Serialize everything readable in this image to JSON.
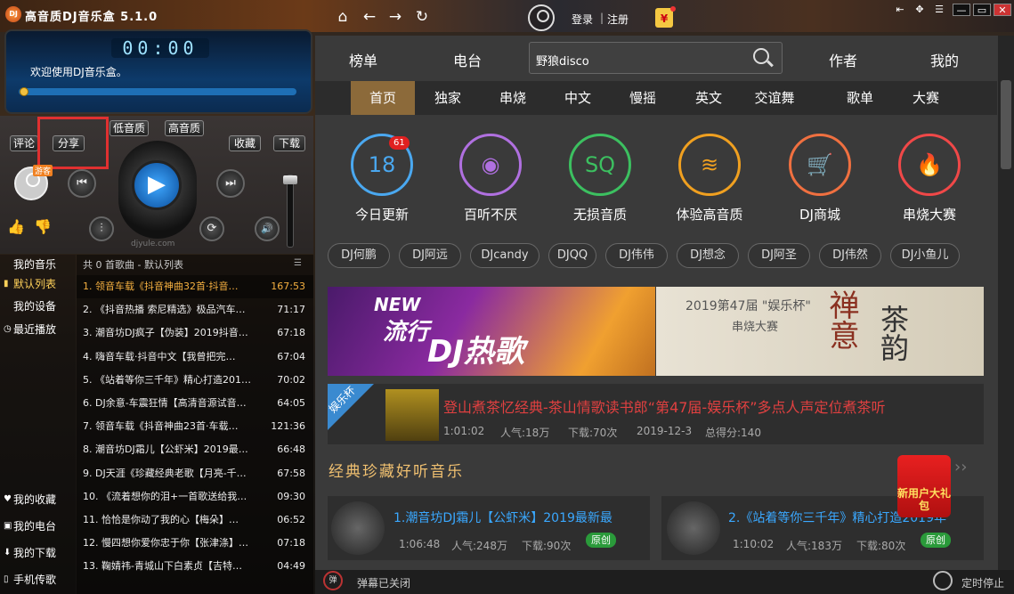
{
  "app": {
    "title": "高音质DJ音乐盒 5.1.0",
    "logo_text": "DJ"
  },
  "topbar": {
    "login": "登录",
    "separator": "|",
    "register": "注册",
    "redpacket": "¥"
  },
  "player": {
    "time": "00:00",
    "welcome": "欢迎使用DJ音乐盒。",
    "progress": 0,
    "buttons": {
      "comment": "评论",
      "share": "分享",
      "low_quality": "低音质",
      "high_quality": "高音质",
      "collect": "收藏",
      "download": "下载"
    },
    "visitor_badge": "游客",
    "watermark": "djyule.com",
    "icons": {
      "prev": "⏮",
      "play": "▶",
      "next": "⏭",
      "eq": "⫶",
      "loop": "⟳",
      "volume": "🔊"
    }
  },
  "menu": {
    "top": [
      {
        "label": "我的音乐",
        "icon": ""
      },
      {
        "label": "默认列表",
        "icon": "▮"
      },
      {
        "label": "我的设备",
        "icon": ""
      },
      {
        "label": "最近播放",
        "icon": "◷"
      }
    ],
    "bottom": [
      {
        "label": "我的收藏",
        "icon": "♥"
      },
      {
        "label": "我的电台",
        "icon": "▣"
      },
      {
        "label": "我的下载",
        "icon": "⬇"
      },
      {
        "label": "手机传歌",
        "icon": "▯"
      }
    ]
  },
  "playlist": {
    "header": "共 0 首歌曲 - 默认列表",
    "rows": [
      {
        "title": "1. 领音车载《抖音神曲32首·抖音…",
        "duration": "167:53"
      },
      {
        "title": "2. 《抖音热播 索尼精选》极品汽车…",
        "duration": "71:17"
      },
      {
        "title": "3. 潮音坊DJ疯子【伪装】2019抖音…",
        "duration": "67:18"
      },
      {
        "title": "4. 嗨音车载·抖音中文【我曾把完…",
        "duration": "67:04"
      },
      {
        "title": "5. 《站着等你三千年》精心打造201…",
        "duration": "70:02"
      },
      {
        "title": "6. DJ余意-车震狂情【高清音源试音…",
        "duration": "64:05"
      },
      {
        "title": "7. 领音车载《抖音神曲23首·车载…",
        "duration": "121:36"
      },
      {
        "title": "8. 潮音坊DJ霜儿【公虾米】2019最…",
        "duration": "66:48"
      },
      {
        "title": "9. DJ天涯《珍藏经典老歌【月亮-千…",
        "duration": "67:58"
      },
      {
        "title": "10. 《流着想你的泪+一首歌送给我…",
        "duration": "09:30"
      },
      {
        "title": "11. 恰恰是你动了我的心【梅朵】…",
        "duration": "06:52"
      },
      {
        "title": "12. 慢四想你爱你忠于你【张津涤】…",
        "duration": "07:18"
      },
      {
        "title": "13. 鞠婧祎-青城山下白素贞【吉特…",
        "duration": "04:49"
      }
    ]
  },
  "main": {
    "top_tabs": [
      "榜单",
      "电台",
      "作者",
      "我的"
    ],
    "search": {
      "value": "野狼disco"
    },
    "sub_tabs": [
      "首页",
      "独家",
      "串烧",
      "中文",
      "慢摇",
      "英文",
      "交谊舞",
      "歌单",
      "大赛"
    ],
    "categories": [
      {
        "label": "今日更新",
        "icon": "18",
        "color": "#4aa8f0"
      },
      {
        "label": "百听不厌",
        "icon": "◉",
        "color": "#b070e0"
      },
      {
        "label": "无损音质",
        "icon": "SQ",
        "color": "#3cc060"
      },
      {
        "label": "体验高音质",
        "icon": "≋",
        "color": "#f0a020"
      },
      {
        "label": "DJ商城",
        "icon": "🛒",
        "color": "#f07040"
      },
      {
        "label": "串烧大赛",
        "icon": "🔥",
        "color": "#f04848"
      }
    ],
    "update_badge": "61",
    "artist_tags": [
      "DJ何鹏",
      "DJ阿远",
      "DJcandy",
      "DJQQ",
      "DJ伟伟",
      "DJ想念",
      "DJ阿圣",
      "DJ伟然",
      "DJ小鱼儿"
    ],
    "banner_left": {
      "line1": "NEW",
      "line2": "流行",
      "line3": "DJ热歌"
    },
    "banner_right": {
      "line1": "2019第47届 \"娱乐杯\"",
      "line2": "串烧大赛",
      "line3": "禅意",
      "line4": "茶韵"
    },
    "featured": {
      "ribbon": "娱乐杯",
      "title": "登山煮茶忆经典-茶山情歌读书郎“第47届-娱乐杯”多点人声定位煮茶听",
      "duration": "1:01:02",
      "popularity": "人气:18万",
      "downloads": "下载:70次",
      "date": "2019-12-3",
      "score": "总得分:140"
    },
    "section_title": "经典珍藏好听音乐",
    "more": "››",
    "cards": [
      {
        "title": "1.潮音坊DJ霜儿【公虾米】2019最新最",
        "duration": "1:06:48",
        "popularity": "人气:248万",
        "downloads": "下载:90次",
        "badge": "原创"
      },
      {
        "title": "2.《站着等你三千年》精心打造2019年",
        "duration": "1:10:02",
        "popularity": "人气:183万",
        "downloads": "下载:80次",
        "badge": "原创"
      }
    ],
    "gift": "新用户大礼包"
  },
  "bottombar": {
    "danmu_icon": "弹",
    "danmu": "弹幕已关闭",
    "timer": "定时停止"
  }
}
